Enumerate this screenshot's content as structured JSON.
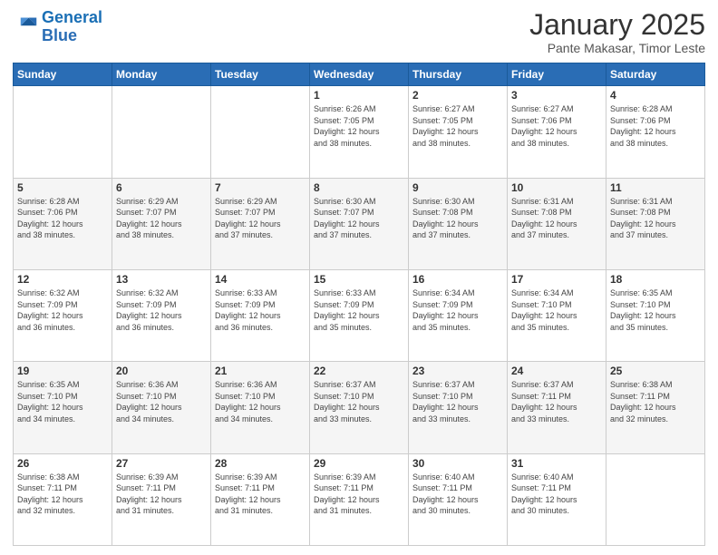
{
  "logo": {
    "line1": "General",
    "line2": "Blue"
  },
  "calendar": {
    "title": "January 2025",
    "subtitle": "Pante Makasar, Timor Leste"
  },
  "weekdays": [
    "Sunday",
    "Monday",
    "Tuesday",
    "Wednesday",
    "Thursday",
    "Friday",
    "Saturday"
  ],
  "weeks": [
    [
      {
        "day": "",
        "info": ""
      },
      {
        "day": "",
        "info": ""
      },
      {
        "day": "",
        "info": ""
      },
      {
        "day": "1",
        "info": "Sunrise: 6:26 AM\nSunset: 7:05 PM\nDaylight: 12 hours\nand 38 minutes."
      },
      {
        "day": "2",
        "info": "Sunrise: 6:27 AM\nSunset: 7:05 PM\nDaylight: 12 hours\nand 38 minutes."
      },
      {
        "day": "3",
        "info": "Sunrise: 6:27 AM\nSunset: 7:06 PM\nDaylight: 12 hours\nand 38 minutes."
      },
      {
        "day": "4",
        "info": "Sunrise: 6:28 AM\nSunset: 7:06 PM\nDaylight: 12 hours\nand 38 minutes."
      }
    ],
    [
      {
        "day": "5",
        "info": "Sunrise: 6:28 AM\nSunset: 7:06 PM\nDaylight: 12 hours\nand 38 minutes."
      },
      {
        "day": "6",
        "info": "Sunrise: 6:29 AM\nSunset: 7:07 PM\nDaylight: 12 hours\nand 38 minutes."
      },
      {
        "day": "7",
        "info": "Sunrise: 6:29 AM\nSunset: 7:07 PM\nDaylight: 12 hours\nand 37 minutes."
      },
      {
        "day": "8",
        "info": "Sunrise: 6:30 AM\nSunset: 7:07 PM\nDaylight: 12 hours\nand 37 minutes."
      },
      {
        "day": "9",
        "info": "Sunrise: 6:30 AM\nSunset: 7:08 PM\nDaylight: 12 hours\nand 37 minutes."
      },
      {
        "day": "10",
        "info": "Sunrise: 6:31 AM\nSunset: 7:08 PM\nDaylight: 12 hours\nand 37 minutes."
      },
      {
        "day": "11",
        "info": "Sunrise: 6:31 AM\nSunset: 7:08 PM\nDaylight: 12 hours\nand 37 minutes."
      }
    ],
    [
      {
        "day": "12",
        "info": "Sunrise: 6:32 AM\nSunset: 7:09 PM\nDaylight: 12 hours\nand 36 minutes."
      },
      {
        "day": "13",
        "info": "Sunrise: 6:32 AM\nSunset: 7:09 PM\nDaylight: 12 hours\nand 36 minutes."
      },
      {
        "day": "14",
        "info": "Sunrise: 6:33 AM\nSunset: 7:09 PM\nDaylight: 12 hours\nand 36 minutes."
      },
      {
        "day": "15",
        "info": "Sunrise: 6:33 AM\nSunset: 7:09 PM\nDaylight: 12 hours\nand 35 minutes."
      },
      {
        "day": "16",
        "info": "Sunrise: 6:34 AM\nSunset: 7:09 PM\nDaylight: 12 hours\nand 35 minutes."
      },
      {
        "day": "17",
        "info": "Sunrise: 6:34 AM\nSunset: 7:10 PM\nDaylight: 12 hours\nand 35 minutes."
      },
      {
        "day": "18",
        "info": "Sunrise: 6:35 AM\nSunset: 7:10 PM\nDaylight: 12 hours\nand 35 minutes."
      }
    ],
    [
      {
        "day": "19",
        "info": "Sunrise: 6:35 AM\nSunset: 7:10 PM\nDaylight: 12 hours\nand 34 minutes."
      },
      {
        "day": "20",
        "info": "Sunrise: 6:36 AM\nSunset: 7:10 PM\nDaylight: 12 hours\nand 34 minutes."
      },
      {
        "day": "21",
        "info": "Sunrise: 6:36 AM\nSunset: 7:10 PM\nDaylight: 12 hours\nand 34 minutes."
      },
      {
        "day": "22",
        "info": "Sunrise: 6:37 AM\nSunset: 7:10 PM\nDaylight: 12 hours\nand 33 minutes."
      },
      {
        "day": "23",
        "info": "Sunrise: 6:37 AM\nSunset: 7:10 PM\nDaylight: 12 hours\nand 33 minutes."
      },
      {
        "day": "24",
        "info": "Sunrise: 6:37 AM\nSunset: 7:11 PM\nDaylight: 12 hours\nand 33 minutes."
      },
      {
        "day": "25",
        "info": "Sunrise: 6:38 AM\nSunset: 7:11 PM\nDaylight: 12 hours\nand 32 minutes."
      }
    ],
    [
      {
        "day": "26",
        "info": "Sunrise: 6:38 AM\nSunset: 7:11 PM\nDaylight: 12 hours\nand 32 minutes."
      },
      {
        "day": "27",
        "info": "Sunrise: 6:39 AM\nSunset: 7:11 PM\nDaylight: 12 hours\nand 31 minutes."
      },
      {
        "day": "28",
        "info": "Sunrise: 6:39 AM\nSunset: 7:11 PM\nDaylight: 12 hours\nand 31 minutes."
      },
      {
        "day": "29",
        "info": "Sunrise: 6:39 AM\nSunset: 7:11 PM\nDaylight: 12 hours\nand 31 minutes."
      },
      {
        "day": "30",
        "info": "Sunrise: 6:40 AM\nSunset: 7:11 PM\nDaylight: 12 hours\nand 30 minutes."
      },
      {
        "day": "31",
        "info": "Sunrise: 6:40 AM\nSunset: 7:11 PM\nDaylight: 12 hours\nand 30 minutes."
      },
      {
        "day": "",
        "info": ""
      }
    ]
  ]
}
